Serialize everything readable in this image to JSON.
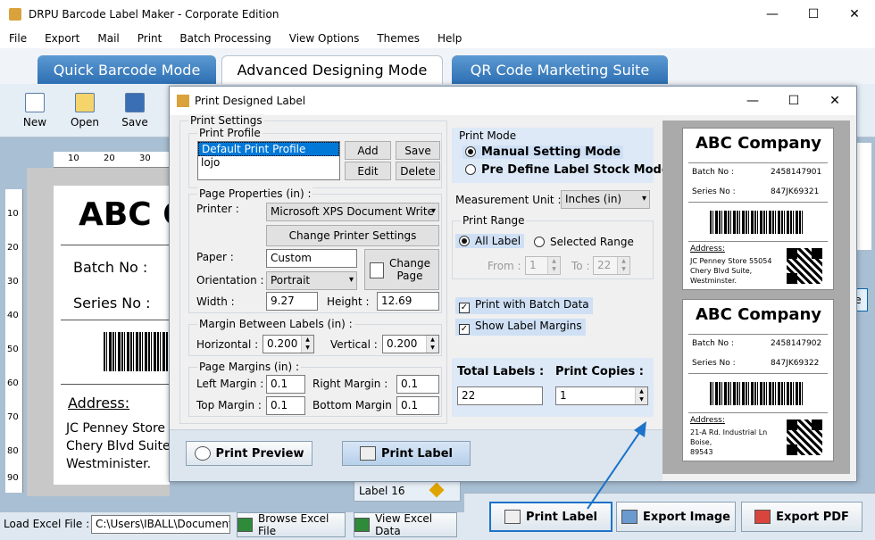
{
  "window": {
    "title": "DRPU Barcode Label Maker - Corporate Edition",
    "min": "—",
    "max": "☐",
    "close": "✕"
  },
  "menu": [
    "File",
    "Export",
    "Mail",
    "Print",
    "Batch Processing",
    "View Options",
    "Themes",
    "Help"
  ],
  "mode_tabs": [
    "Quick Barcode Mode",
    "Advanced Designing Mode",
    "QR Code Marketing Suite"
  ],
  "toolbar": {
    "new": "New",
    "open": "Open",
    "save": "Save"
  },
  "ruler_top": [
    "10",
    "20",
    "30"
  ],
  "ruler_left": [
    "10",
    "20",
    "30",
    "40",
    "50",
    "60",
    "70",
    "80",
    "90"
  ],
  "canvas_label": {
    "company": "ABC C",
    "batch": "Batch No :",
    "series": "Series No :",
    "address_title": "Address:",
    "address_lines": [
      "JC Penney Store",
      "Chery Blvd Suite",
      "Westminister."
    ]
  },
  "bottom": {
    "load_excel_label": "Load Excel File :",
    "excel_path": "C:\\Users\\IBALL\\Document",
    "browse": "Browse Excel File",
    "view": "View Excel Data",
    "label16": "Label 16",
    "print_label": "Print Label",
    "export_image": "Export Image",
    "export_pdf": "Export PDF"
  },
  "dialog": {
    "title": "Print Designed Label",
    "print_settings": "Print Settings",
    "print_profile": "Print Profile",
    "profiles": [
      "Default Print Profile",
      "lojo"
    ],
    "add": "Add",
    "save": "Save",
    "edit": "Edit",
    "delete": "Delete",
    "page_properties": "Page Properties (in) :",
    "printer_label": "Printer :",
    "printer_value": "Microsoft XPS Document Write",
    "change_printer": "Change Printer Settings",
    "paper_label": "Paper :",
    "paper_value": "Custom",
    "orientation_label": "Orientation :",
    "orientation_value": "Portrait",
    "change_page": "Change\nPage",
    "width_label": "Width :",
    "width_value": "9.27",
    "height_label": "Height :",
    "height_value": "12.69",
    "margin_between": "Margin Between Labels (in) :",
    "horizontal_label": "Horizontal :",
    "horizontal_value": "0.200",
    "vertical_label": "Vertical :",
    "vertical_value": "0.200",
    "page_margins": "Page Margins (in) :",
    "left_margin_label": "Left Margin :",
    "left_margin_value": "0.1",
    "right_margin_label": "Right Margin :",
    "right_margin_value": "0.1",
    "top_margin_label": "Top Margin :",
    "top_margin_value": "0.1",
    "bottom_margin_label": "Bottom Margin :",
    "bottom_margin_value": "0.1",
    "print_mode": "Print Mode",
    "manual_mode": "Manual Setting Mode",
    "predefine_mode": "Pre Define Label Stock Mode",
    "measurement_label": "Measurement Unit :",
    "measurement_value": "Inches (in)",
    "print_range": "Print Range",
    "all_label": "All Label",
    "selected_range": "Selected Range",
    "from_label": "From :",
    "from_value": "1",
    "to_label": "To :",
    "to_value": "22",
    "batch_data": "Print with Batch Data",
    "label_margins": "Show Label Margins",
    "total_labels_title": "Total Labels :",
    "total_labels_value": "22",
    "print_copies_title": "Print Copies :",
    "print_copies_value": "1",
    "print_preview": "Print Preview",
    "print_label": "Print Label"
  },
  "preview_cards": [
    {
      "company": "ABC Company",
      "batch_label": "Batch No :",
      "batch": "2458147901",
      "series_label": "Series No :",
      "series": "847JK69321",
      "address_title": "Address:",
      "address": [
        "JC Penney Store 55054",
        "Chery Blvd Suite,",
        "Westminster."
      ]
    },
    {
      "company": "ABC Company",
      "batch_label": "Batch No :",
      "batch": "2458147902",
      "series_label": "Series No :",
      "series": "847JK69322",
      "address_title": "Address:",
      "address": [
        "21-A Rd. Industrial Ln",
        "Boise,",
        "89543"
      ]
    }
  ],
  "colors": {
    "accent": "#2c6fb3",
    "arrow": "#1c73c9"
  }
}
